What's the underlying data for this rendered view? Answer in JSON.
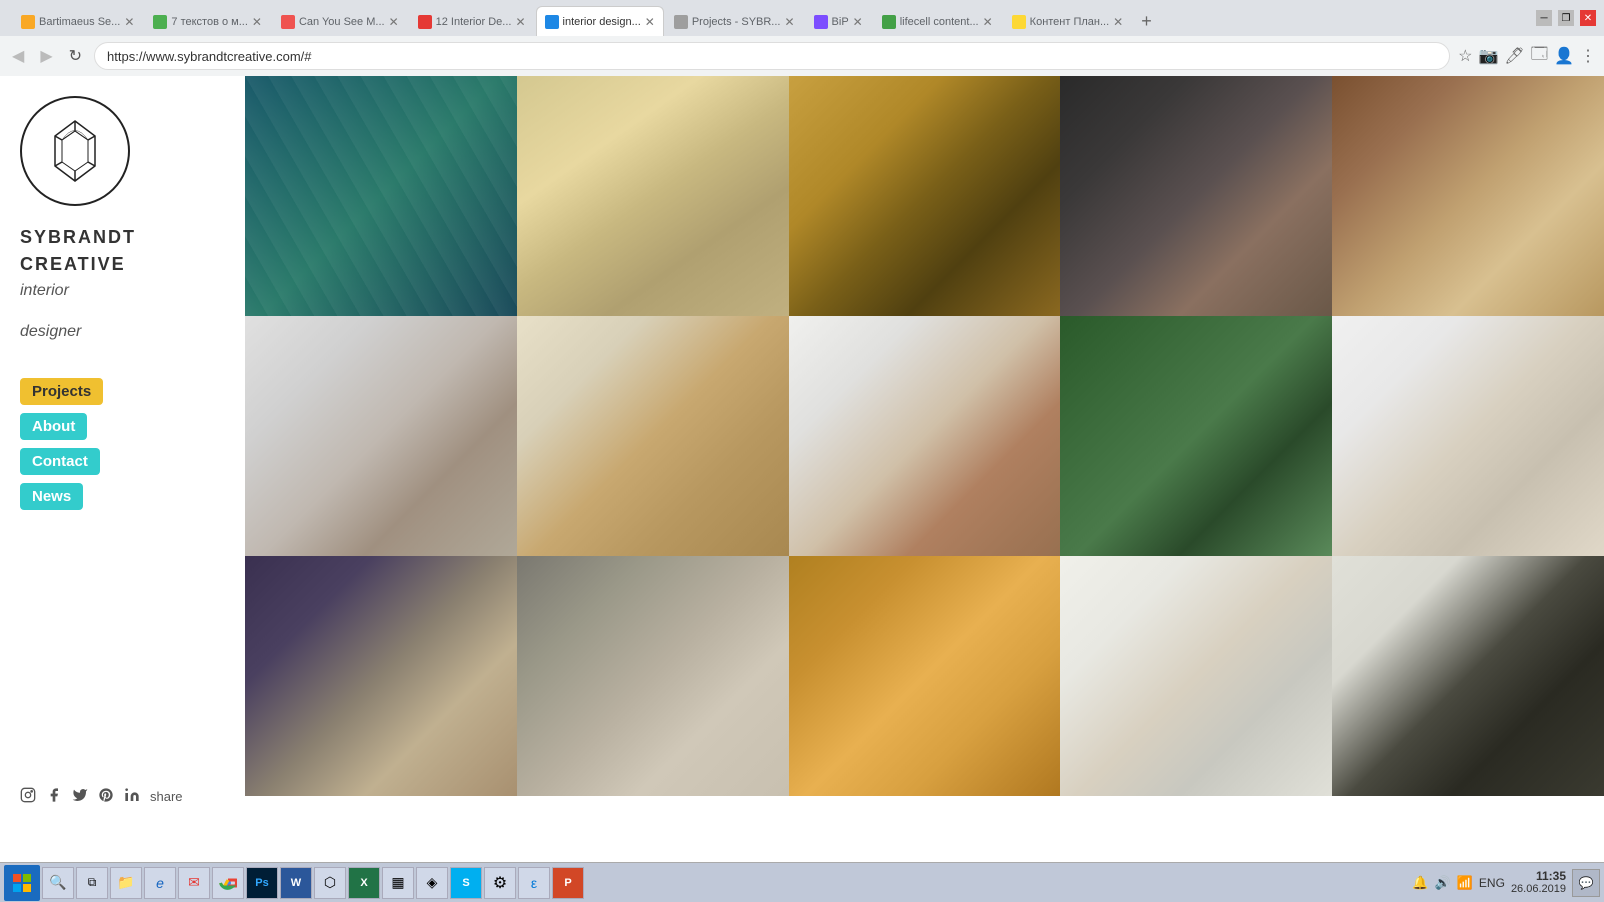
{
  "browser": {
    "url": "https://www.sybrandtcreative.com/#",
    "tabs": [
      {
        "id": "tab1",
        "label": "Bartimaeus Se...",
        "favicon_color": "#f9a825",
        "active": false
      },
      {
        "id": "tab2",
        "label": "7 текстов о м...",
        "favicon_color": "#4caf50",
        "active": false
      },
      {
        "id": "tab3",
        "label": "Can You See M...",
        "favicon_color": "#ef5350",
        "active": false
      },
      {
        "id": "tab4",
        "label": "12 Interior De...",
        "favicon_color": "#e53935",
        "active": false
      },
      {
        "id": "tab5",
        "label": "interior design...",
        "favicon_color": "#1e88e5",
        "active": true
      },
      {
        "id": "tab6",
        "label": "Projects - SYBR...",
        "favicon_color": "#9e9e9e",
        "active": false
      },
      {
        "id": "tab7",
        "label": "BiP",
        "favicon_color": "#7c4dff",
        "active": false
      },
      {
        "id": "tab8",
        "label": "lifecell content...",
        "favicon_color": "#43a047",
        "active": false
      },
      {
        "id": "tab9",
        "label": "Контент План...",
        "favicon_color": "#fdd835",
        "active": false
      }
    ]
  },
  "sidebar": {
    "brand_line1": "SYBRANDT",
    "brand_line2": "CREATIVE",
    "brand_line3": "interior",
    "brand_line4": "designer",
    "nav": [
      {
        "id": "projects",
        "label": "Projects",
        "style": "yellow"
      },
      {
        "id": "about",
        "label": "About",
        "style": "teal"
      },
      {
        "id": "contact",
        "label": "Contact",
        "style": "teal"
      },
      {
        "id": "news",
        "label": "News",
        "style": "teal"
      }
    ],
    "social": [
      "instagram",
      "facebook",
      "twitter",
      "pinterest",
      "linkedin"
    ],
    "share_label": "share"
  },
  "grid": {
    "items": [
      {
        "id": 1,
        "photo_class": "photo-teal-hex"
      },
      {
        "id": 2,
        "photo_class": "photo-kitchen-white"
      },
      {
        "id": 3,
        "photo_class": "photo-stairs-gold"
      },
      {
        "id": 4,
        "photo_class": "photo-tv-room"
      },
      {
        "id": 5,
        "photo_class": "photo-kitchen-wood"
      },
      {
        "id": 6,
        "photo_class": "photo-bathroom"
      },
      {
        "id": 7,
        "photo_class": "photo-kitchen-bar"
      },
      {
        "id": 8,
        "photo_class": "photo-table"
      },
      {
        "id": 9,
        "photo_class": "photo-green-wall"
      },
      {
        "id": 10,
        "photo_class": "photo-kitchen-wh2"
      },
      {
        "id": 11,
        "photo_class": "photo-kitchen-dark"
      },
      {
        "id": 12,
        "photo_class": "photo-living"
      },
      {
        "id": 13,
        "photo_class": "photo-lamp-gold"
      },
      {
        "id": 14,
        "photo_class": "photo-bright-room"
      },
      {
        "id": 15,
        "photo_class": "photo-living-tv"
      }
    ]
  },
  "taskbar": {
    "time": "11:35",
    "date": "26.06.2019",
    "language": "ENG",
    "apps": [
      {
        "id": "start",
        "icon": "⊞",
        "label": "Start"
      },
      {
        "id": "search",
        "icon": "🔍",
        "label": "Search"
      },
      {
        "id": "task-view",
        "icon": "⧉",
        "label": "Task View"
      },
      {
        "id": "file-explorer",
        "icon": "📁",
        "label": "File Explorer"
      },
      {
        "id": "ie",
        "icon": "ℯ",
        "label": "Internet Explorer"
      },
      {
        "id": "outlook-task",
        "icon": "✉",
        "label": "Outlook"
      },
      {
        "id": "chrome",
        "icon": "◉",
        "label": "Chrome"
      },
      {
        "id": "photoshop",
        "icon": "Ps",
        "label": "Photoshop"
      },
      {
        "id": "word",
        "icon": "W",
        "label": "Word"
      },
      {
        "id": "app9",
        "icon": "⬡",
        "label": "App"
      },
      {
        "id": "excel",
        "icon": "X",
        "label": "Excel"
      },
      {
        "id": "calc",
        "icon": "▦",
        "label": "Calculator"
      },
      {
        "id": "app12",
        "icon": "◈",
        "label": "App"
      },
      {
        "id": "skype",
        "icon": "S",
        "label": "Skype"
      },
      {
        "id": "settings",
        "icon": "⚙",
        "label": "Settings"
      },
      {
        "id": "edge",
        "icon": "ε",
        "label": "Edge"
      },
      {
        "id": "powerpoint",
        "icon": "P",
        "label": "PowerPoint"
      }
    ]
  }
}
